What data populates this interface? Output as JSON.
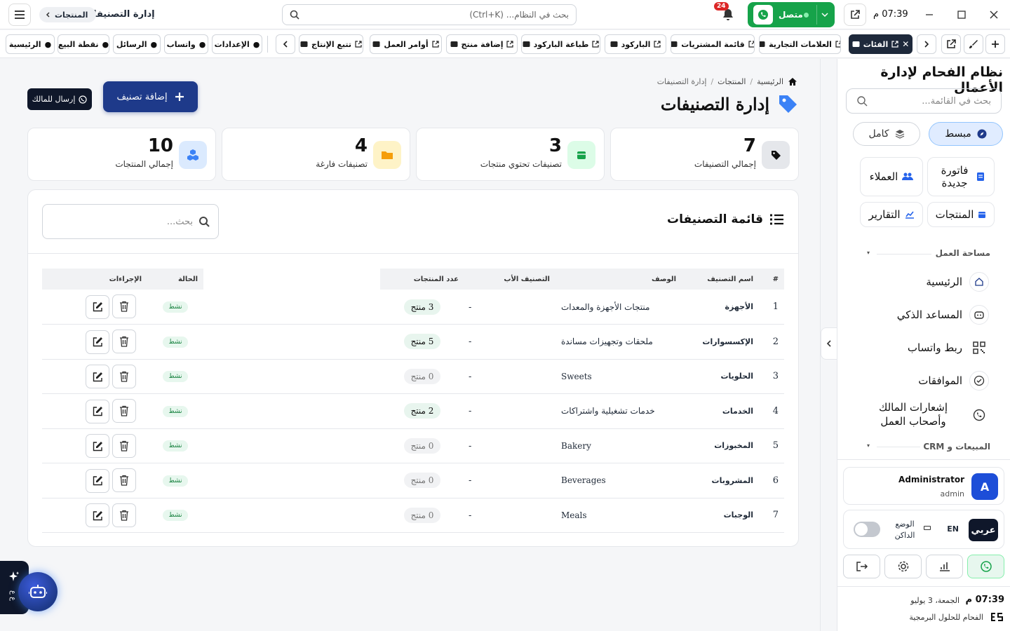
{
  "titlebar": {
    "clock": "07:39 م",
    "connection_label": "متصل",
    "notification_count": "24",
    "search_placeholder": "بحث في النظام... (Ctrl+K)",
    "page_title": "إدارة التصنيفات",
    "crumb": "المنتجات"
  },
  "tabs": [
    {
      "label": "الفئات",
      "active": true
    },
    {
      "label": "العلامات التجارية"
    },
    {
      "label": "قائمة المشتريات"
    },
    {
      "label": "الباركود"
    },
    {
      "label": "طباعة الباركود"
    },
    {
      "label": "إضافة منتج"
    },
    {
      "label": "أوامر العمل"
    },
    {
      "label": "تتبع الإنتاج"
    }
  ],
  "quick_tabs": [
    {
      "label": "الإعدادات"
    },
    {
      "label": "واتساب"
    },
    {
      "label": "الرسائل"
    },
    {
      "label": "نقطة البيع"
    },
    {
      "label": "الرئيسية"
    }
  ],
  "sidebar": {
    "brand": "نظام الفحام لإدارة الأعمال",
    "search_placeholder": "بحث في القائمة...",
    "mode_simple": "مبسط",
    "mode_full": "كامل",
    "quick": [
      {
        "label": "فاتورة جديدة"
      },
      {
        "label": "العملاء"
      },
      {
        "label": "المنتجات"
      },
      {
        "label": "التقارير"
      }
    ],
    "section_workspace": "مساحة العمل",
    "nav": [
      {
        "label": "الرئيسية"
      },
      {
        "label": "المساعد الذكي"
      },
      {
        "label": "ربط واتساب"
      },
      {
        "label": "الموافقات"
      },
      {
        "label": "إشعارات المالك وأصحاب العمل"
      }
    ],
    "section_sales": "المبيعات و CRM",
    "user_name": "Administrator",
    "user_login": "admin",
    "avatar_letter": "A",
    "lang_ar": "عربي",
    "lang_en": "EN",
    "dark_mode": "الوضع الداكن",
    "footer_time": "07:39 م",
    "footer_date": "الجمعة، 3 يوليو",
    "footer_company": "الفحام للحلول البرمجية"
  },
  "main": {
    "breadcrumb": [
      "الرئيسية",
      "المنتجات",
      "إدارة التصنيفات"
    ],
    "title": "إدارة التصنيفات",
    "add_button": "إضافة تصنيف",
    "send_owner_button": "إرسال للمالك",
    "stats": [
      {
        "value": "7",
        "label": "إجمالي التصنيفات",
        "color": "#e5e7eb"
      },
      {
        "value": "3",
        "label": "تصنيفات تحتوي منتجات",
        "color": "#dcfce7"
      },
      {
        "value": "4",
        "label": "تصنيفات فارغة",
        "color": "#fef3c7"
      },
      {
        "value": "10",
        "label": "إجمالي المنتجات",
        "color": "#dbeafe"
      }
    ],
    "list_title": "قائمة التصنيفات",
    "list_search_placeholder": "بحث...",
    "columns": [
      "#",
      "اسم التصنيف",
      "الوصف",
      "التصنيف الأب",
      "عدد المنتجات",
      "",
      "الحالة",
      "الإجراءات"
    ],
    "rows": [
      {
        "n": "1",
        "name": "الأجهزة",
        "desc": "منتجات الأجهزة والمعدات",
        "parent": "-",
        "count": "3 منتج",
        "status": "نشط",
        "has": true
      },
      {
        "n": "2",
        "name": "الإكسسوارات",
        "desc": "ملحقات وتجهيزات مساندة",
        "parent": "-",
        "count": "5 منتج",
        "status": "نشط",
        "has": true
      },
      {
        "n": "3",
        "name": "الحلويات",
        "desc": "Sweets",
        "parent": "-",
        "count": "0 منتج",
        "status": "نشط",
        "has": false
      },
      {
        "n": "4",
        "name": "الخدمات",
        "desc": "خدمات تشغيلية واشتراكات",
        "parent": "-",
        "count": "2 منتج",
        "status": "نشط",
        "has": true
      },
      {
        "n": "5",
        "name": "المخبوزات",
        "desc": "Bakery",
        "parent": "-",
        "count": "0 منتج",
        "status": "نشط",
        "has": false
      },
      {
        "n": "6",
        "name": "المشروبات",
        "desc": "Beverages",
        "parent": "-",
        "count": "0 منتج",
        "status": "نشط",
        "has": false
      },
      {
        "n": "7",
        "name": "الوجبات",
        "desc": "Meals",
        "parent": "-",
        "count": "0 منتج",
        "status": "نشط",
        "has": false
      }
    ]
  },
  "ai_fab_label": "ع ع",
  "colors": {
    "primary": "#1e3a8a",
    "dark": "#0f172a",
    "green": "#16a34a",
    "tag_blue": "#3b82f6"
  }
}
